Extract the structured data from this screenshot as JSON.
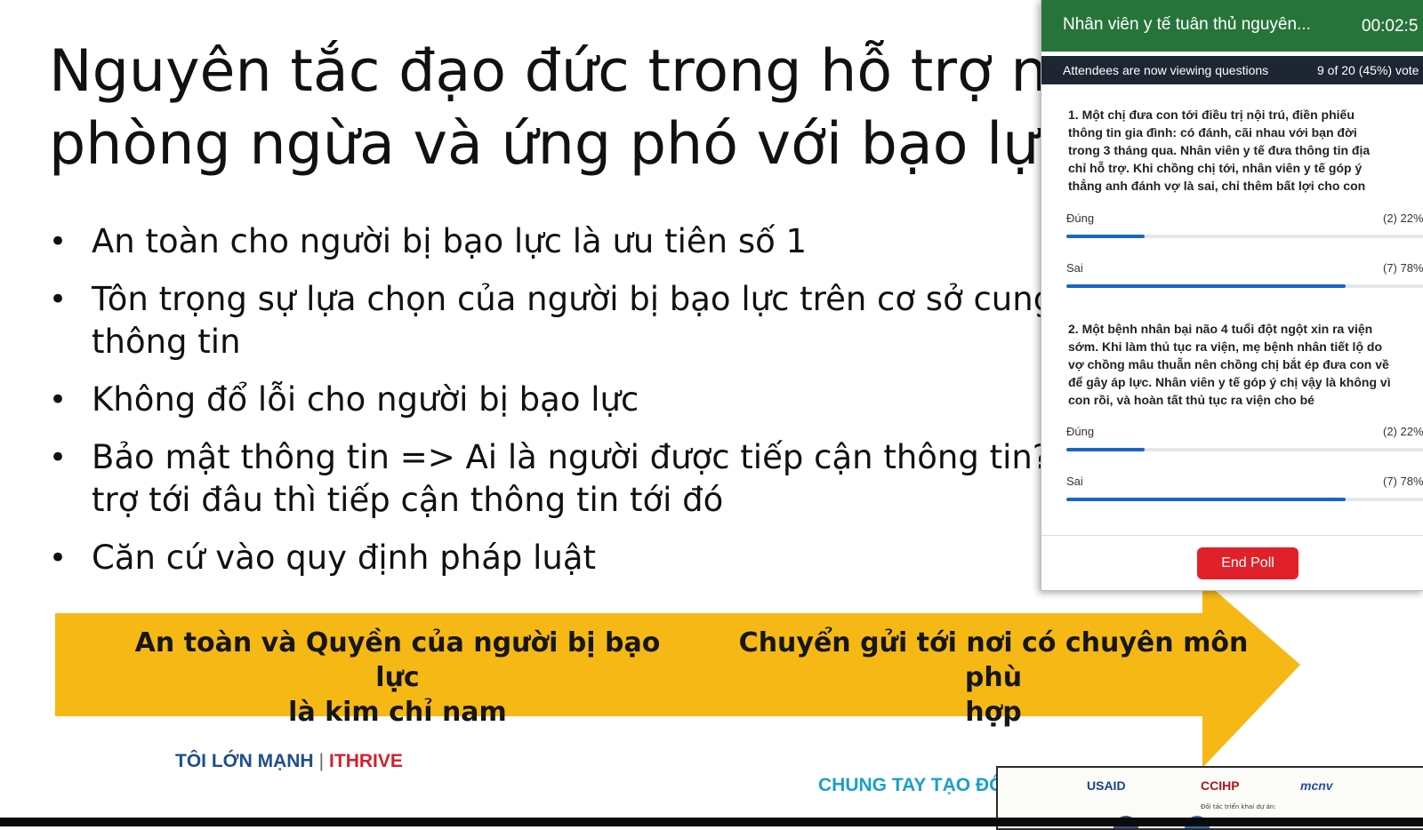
{
  "slide": {
    "title_lines": [
      "Nguyên tắc đạo đức trong hỗ trợ ngư",
      "phòng ngừa và ứng phó với bạo lực"
    ],
    "bullet_symbol": "•",
    "bullets": [
      [
        "An toàn cho người bị bạo lực là ưu tiên số 1"
      ],
      [
        "Tôn trọng sự lựa chọn của người bị bạo lực trên cơ sở cung",
        "thông tin"
      ],
      [
        "Không đổ lỗi cho người bị bạo lực"
      ],
      [
        "Bảo mật thông tin => Ai là người được tiếp cận thông tin?",
        "trợ tới đâu thì tiếp cận thông tin tới đó"
      ],
      [
        "Căn cứ vào quy định pháp luật"
      ]
    ],
    "arrow": {
      "color": "#f6b815",
      "left_text_lines": [
        "An toàn và Quyền của người bị bạo lực",
        "là kim chỉ nam"
      ],
      "right_text_lines": [
        "Chuyển gửi tới nơi có chuyên môn phù",
        "hợp"
      ]
    },
    "footer": {
      "brand_left": "TÔI LỚN MẠNH",
      "brand_sep": "|",
      "brand_right": "ITHRIVE",
      "tagline": "CHUNG TAY TẠO ĐỔ"
    },
    "partners": {
      "usaid": "USAID",
      "ccihp": "CCIHP",
      "mcnv": "mcnv",
      "caption": "Đối tác triển khai dự án:"
    }
  },
  "poll": {
    "title": "Nhân viên y tế tuân thủ nguyên...",
    "timer": "00:02:5",
    "status": "Attendees are now viewing questions",
    "votes": "9 of 20 (45%) vote",
    "accent_color": "#27743a",
    "bar_color": "#1c64c8",
    "questions": [
      {
        "lines": [
          "1. Một chị đưa con tới điều trị nội trú, điền phiếu",
          "thông tin gia đình: có đánh, cãi nhau với bạn đời",
          "trong 3 tháng qua. Nhân viên y tế đưa thông tin địa",
          "chỉ hỗ trợ. Khi chồng chị tới, nhân viên y tế góp ý",
          "thẳng anh đánh vợ là sai, chỉ thêm bất lợi cho con"
        ],
        "options": [
          {
            "label": "Đúng",
            "count": "(2) 22%",
            "fraction": 0.22
          },
          {
            "label": "Sai",
            "count": "(7) 78%",
            "fraction": 0.78
          }
        ]
      },
      {
        "lines": [
          "2. Một bệnh nhân bại não 4 tuổi đột ngột xin ra viện",
          "sớm. Khi làm thủ tục ra viện, mẹ bệnh nhân tiết lộ do",
          "vợ chồng mâu thuẫn nên chồng chị bắt ép đưa con về",
          "để gây áp lực. Nhân viên y tế góp ý chị vậy là không vì",
          "con rồi, và hoàn tất thủ tục ra viện cho bé"
        ],
        "options": [
          {
            "label": "Đúng",
            "count": "(2) 22%",
            "fraction": 0.22
          },
          {
            "label": "Sai",
            "count": "(7) 78%",
            "fraction": 0.78
          }
        ]
      }
    ],
    "end_button": "End Poll"
  }
}
